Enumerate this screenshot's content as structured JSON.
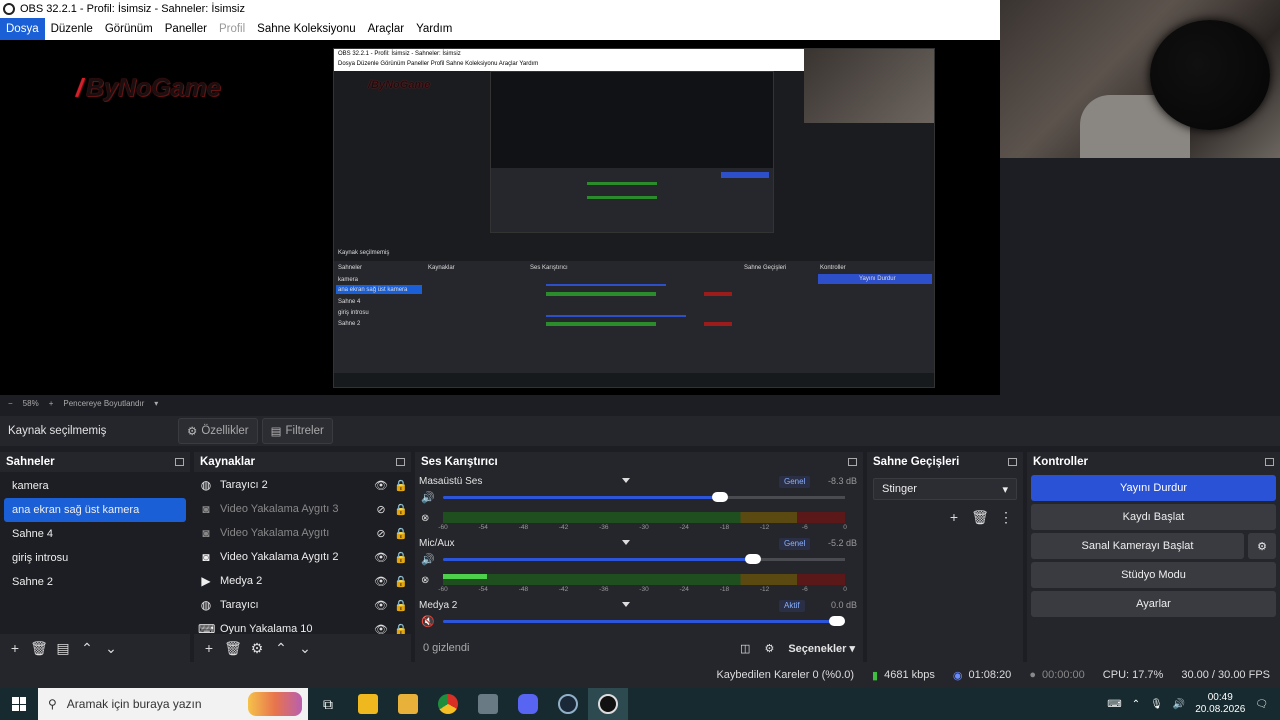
{
  "window": {
    "title": "OBS 32.2.1 - Profil: İsimsiz - Sahneler: İsimsiz"
  },
  "menu": [
    "Dosya",
    "Düzenle",
    "Görünüm",
    "Paneller",
    "Profil",
    "Sahne Koleksiyonu",
    "Araçlar",
    "Yardım"
  ],
  "preview": {
    "brand": "ByNoGame",
    "zoom": "58%",
    "fit_label": "Pencereye Boyutlandır"
  },
  "source_toolbar": {
    "no_source": "Kaynak seçilmemiş",
    "properties": "Özellikler",
    "filters": "Filtreler"
  },
  "scenes": {
    "title": "Sahneler",
    "items": [
      "kamera",
      "ana ekran sağ üst  kamera",
      "Sahne 4",
      "giriş introsu",
      "Sahne 2"
    ],
    "selected_index": 1
  },
  "sources": {
    "title": "Kaynaklar",
    "items": [
      {
        "label": "Tarayıcı 2",
        "icon": "globe-icon",
        "visible": true
      },
      {
        "label": "Video Yakalama Aygıtı 3",
        "icon": "camera-icon",
        "visible": false
      },
      {
        "label": "Video Yakalama Aygıtı",
        "icon": "camera-icon",
        "visible": false
      },
      {
        "label": "Video Yakalama Aygıtı 2",
        "icon": "camera-icon",
        "visible": true
      },
      {
        "label": "Medya 2",
        "icon": "play-icon",
        "visible": true
      },
      {
        "label": "Tarayıcı",
        "icon": "globe-icon",
        "visible": true
      },
      {
        "label": "Oyun Yakalama 10",
        "icon": "gamepad-icon",
        "visible": true
      }
    ]
  },
  "mixer": {
    "title": "Ses Karıştırıcı",
    "channels": [
      {
        "name": "Masaüstü Ses",
        "badge": "Genel",
        "db": "-8.3 dB",
        "volume": 0.69,
        "level": 0.0,
        "muted": false
      },
      {
        "name": "Mic/Aux",
        "badge": "Genel",
        "db": "-5.2 dB",
        "volume": 0.77,
        "level": 0.11,
        "muted": false
      },
      {
        "name": "Medya 2",
        "badge": "Aktif",
        "db": "0.0 dB",
        "volume": 0.98,
        "level": 0.0,
        "muted": true
      }
    ],
    "scale": [
      "-60",
      "-54",
      "-48",
      "-42",
      "-36",
      "-30",
      "-24",
      "-18",
      "-12",
      "-6",
      "0"
    ],
    "hidden_label": "0 gizlendi",
    "options_label": "Seçenekler"
  },
  "transitions": {
    "title": "Sahne Geçişleri",
    "selected": "Stinger"
  },
  "controls": {
    "title": "Kontroller",
    "stop_stream": "Yayını Durdur",
    "start_record": "Kaydı Başlat",
    "virtual_cam": "Sanal Kamerayı Başlat",
    "studio_mode": "Stüdyo Modu",
    "settings": "Ayarlar"
  },
  "status": {
    "dropped": "Kaybedilen Kareler 0 (%0.0)",
    "bitrate": "4681 kbps",
    "stream_time": "01:08:20",
    "record_time": "00:00:00",
    "cpu": "CPU: 17.7%",
    "fps": "30.00 / 30.00 FPS"
  },
  "taskbar": {
    "search_placeholder": "Aramak için buraya yazın",
    "time": "00:49",
    "date": "20.08.2026"
  },
  "colors": {
    "accent": "#1b5fd6",
    "stream_button": "#2a52d6",
    "dock_bg": "#25262c",
    "panel_bg": "#1d1e23"
  }
}
